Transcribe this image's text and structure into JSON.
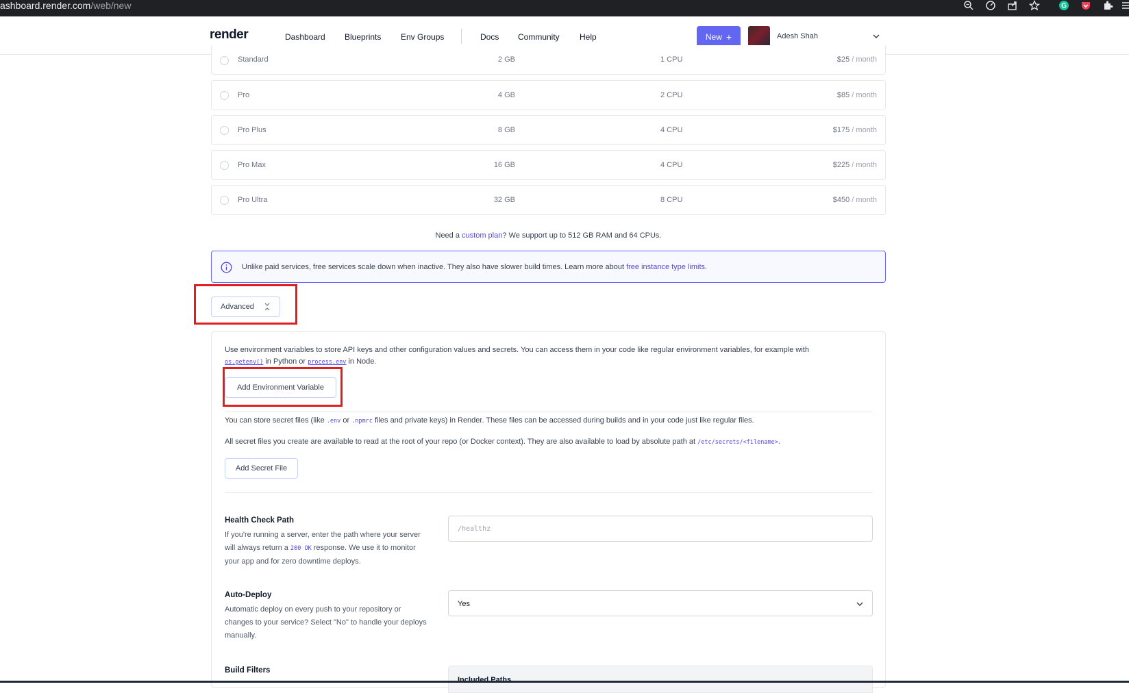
{
  "browser": {
    "url_host": "ashboard.render.com",
    "url_path": "/web/new",
    "icons": [
      "zoom-icon",
      "performance-icon",
      "share-icon",
      "star-icon",
      "grammarly-icon",
      "pocket-icon",
      "extensions-icon",
      "menu-icon"
    ]
  },
  "nav": {
    "logo": "render",
    "links": [
      "Dashboard",
      "Blueprints",
      "Env Groups",
      "Docs",
      "Community",
      "Help"
    ],
    "active": "Dashboard",
    "new_button": "New",
    "new_button_icon": "+",
    "user_name": "Adesh Shah",
    "accent_color": "#6366f1"
  },
  "plans": [
    {
      "name": "Standard",
      "ram": "2 GB",
      "cpu": "1 CPU",
      "price": "$25",
      "period": " / month"
    },
    {
      "name": "Pro",
      "ram": "4 GB",
      "cpu": "2 CPU",
      "price": "$85",
      "period": " / month"
    },
    {
      "name": "Pro Plus",
      "ram": "8 GB",
      "cpu": "4 CPU",
      "price": "$175",
      "period": " / month"
    },
    {
      "name": "Pro Max",
      "ram": "16 GB",
      "cpu": "4 CPU",
      "price": "$225",
      "period": " / month"
    },
    {
      "name": "Pro Ultra",
      "ram": "32 GB",
      "cpu": "8 CPU",
      "price": "$450",
      "period": " / month"
    }
  ],
  "custom_plan": {
    "before": "Need a ",
    "link": "custom plan",
    "after": "? We support up to 512 GB RAM and 64 CPUs."
  },
  "info": {
    "text": "Unlike paid services, free services scale down when inactive. They also have slower build times. Learn more about ",
    "link": "free instance type limits",
    "end": "."
  },
  "advanced": {
    "label": "Advanced",
    "toggle_icon": "collapse-icon",
    "env_text_1": "Use environment variables to store API keys and other configuration values and secrets. You can access them in your code like regular environment variables, for example with",
    "env_code_1": "os.getenv()",
    "env_text_2": " in Python or ",
    "env_code_2": "process.env",
    "env_text_3": " in Node.",
    "add_env_button": "Add Environment Variable",
    "secret_text_1a": "You can store secret files (like ",
    "secret_code_1": ".env",
    "secret_text_1b": " or ",
    "secret_code_2": ".npmrc",
    "secret_text_1c": " files and private keys) in Render. These files can be accessed during builds and in your code just like regular files.",
    "secret_text_2a": "All secret files you create are available to read at the root of your repo (or Docker context). They are also available to load by absolute path at ",
    "secret_code_3": "/etc/secrets/<filename>",
    "secret_text_2b": ".",
    "add_secret_button": "Add Secret File",
    "health": {
      "label": "Health Check Path",
      "desc_a": "If you're running a server, enter the path where your server will always return a ",
      "desc_code": "200 OK",
      "desc_b": " response. We use it to monitor your app and for zero downtime deploys.",
      "placeholder": "/healthz"
    },
    "autodeploy": {
      "label": "Auto-Deploy",
      "desc": "Automatic deploy on every push to your repository or changes to your service? Select \"No\" to handle your deploys manually.",
      "value": "Yes"
    },
    "build_filters": {
      "label": "Build Filters",
      "included_paths": "Included Paths"
    }
  },
  "highlight_color": "#e11d1d"
}
